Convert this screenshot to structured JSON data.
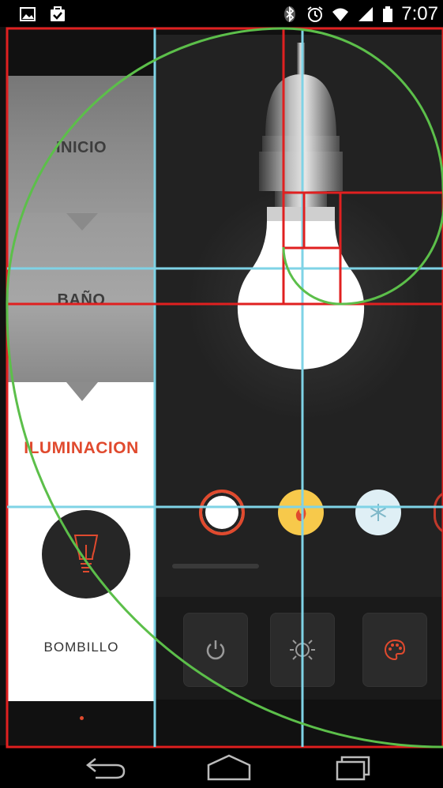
{
  "status_bar": {
    "time": "7:07",
    "left_icons": [
      "image-icon",
      "briefcase-check-icon"
    ],
    "right_icons": [
      "bluetooth-icon",
      "alarm-icon",
      "wifi-icon",
      "signal-icon",
      "battery-icon"
    ]
  },
  "menu": {
    "items": [
      {
        "label": "INICIO",
        "active": false
      },
      {
        "label": "BAÑO",
        "active": false
      },
      {
        "label": "ILUMINACION",
        "active": true
      }
    ]
  },
  "device": {
    "icon": "lightbulb-icon",
    "label": "BOMBILLO"
  },
  "colors": {
    "accent": "#e04a2e",
    "warm": "#f7c94b",
    "cold": "#dfeff5",
    "white": "#ffffff",
    "panel_dark": "#222222",
    "guide_red": "#e02020",
    "guide_cyan": "#7fd3e6",
    "guide_green": "#5cbf4a"
  },
  "color_swatches": [
    {
      "name": "white",
      "selected": true
    },
    {
      "name": "warm",
      "icon": "flame-icon"
    },
    {
      "name": "cold",
      "icon": "snowflake-icon"
    },
    {
      "name": "red",
      "partial": true
    }
  ],
  "controls": [
    {
      "name": "power",
      "icon": "power-icon"
    },
    {
      "name": "brightness",
      "icon": "brightness-icon"
    },
    {
      "name": "palette",
      "icon": "palette-icon"
    }
  ],
  "nav": {
    "buttons": [
      "back-icon",
      "home-icon",
      "recent-apps-icon"
    ]
  }
}
